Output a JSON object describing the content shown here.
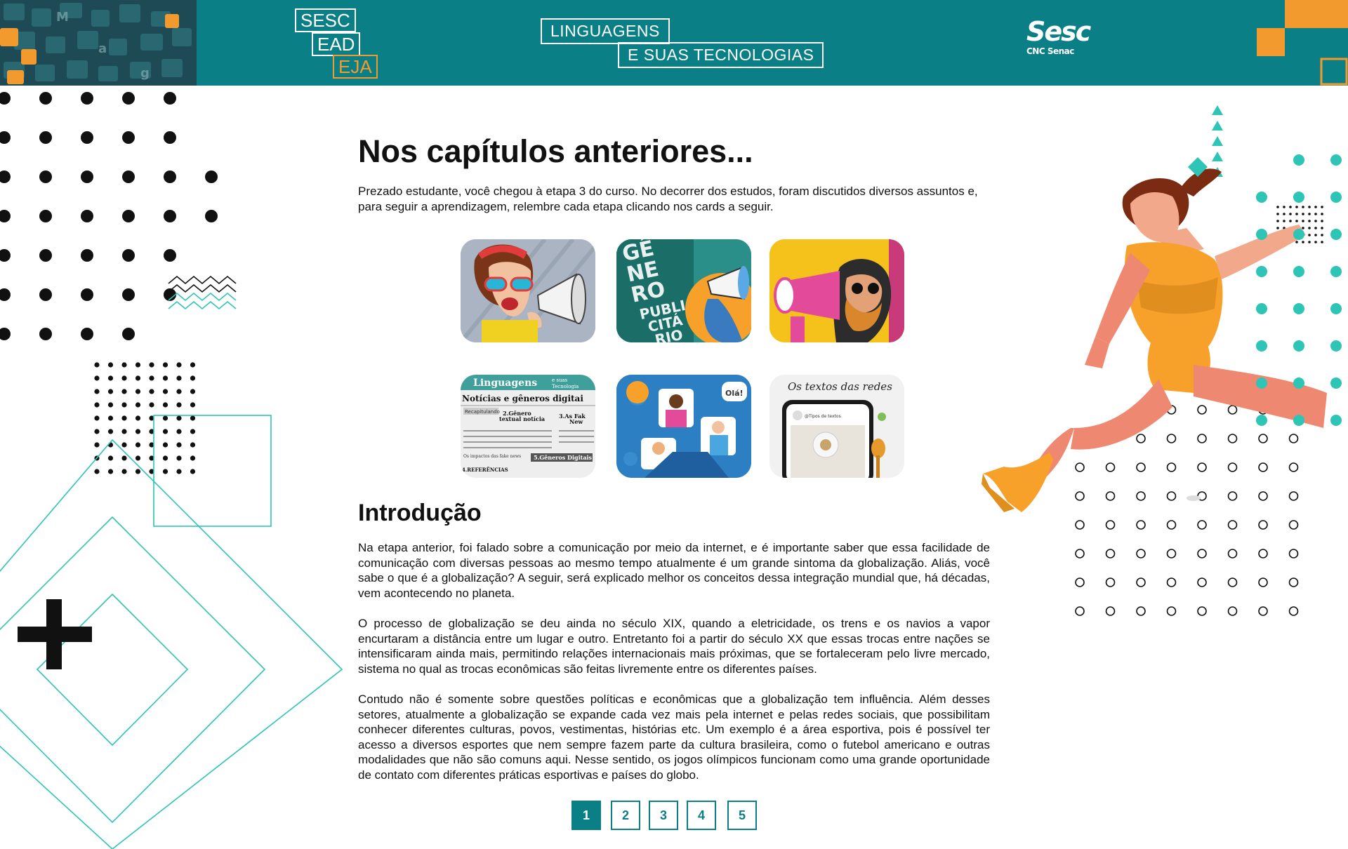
{
  "header": {
    "logo_eja": {
      "line1": "SESC",
      "line2": "EAD",
      "line3": "EJA"
    },
    "course_title": {
      "line1": "LINGUAGENS",
      "line2": "E SUAS TECNOLOGIAS"
    },
    "brand": {
      "name": "Sesc",
      "sub": "CNC Senac"
    }
  },
  "main": {
    "title": "Nos capítulos anteriores...",
    "lead": "Prezado estudante, você chegou à etapa 3 do curso. No decorrer dos estudos, foram discutidos diversos assuntos e, para seguir a aprendizagem, relembre cada etapa clicando nos cards a seguir.",
    "cards": [
      {
        "text": "",
        "icon": "megaphone-woman-icon"
      },
      {
        "text": "GÊ NE RO PUBLI CITÁ RIO",
        "icon": "megaphone-icon"
      },
      {
        "text": "",
        "icon": "megaphone-man-icon"
      },
      {
        "text": "Linguagens e suas Tecnologias — Notícias e gêneros digitais — Recapitulando — 2.Gênero textual notícia — 3.As Fake News — 5.Gêneros Digitais — 4.REFERÊNCIAS",
        "icon": "newspaper-icon"
      },
      {
        "text": "Olá!",
        "icon": "video-call-icon"
      },
      {
        "text": "Os textos das redes",
        "icon": "phone-icon"
      }
    ],
    "section_title": "Introdução",
    "paragraphs": [
      "Na etapa anterior, foi falado sobre a comunicação por meio da internet, e é importante saber que essa facilidade de comunicação com diversas pessoas ao mesmo tempo atualmente é um grande sintoma da globalização. Aliás, você sabe o que é a globalização? A seguir, será explicado melhor os conceitos dessa integração mundial que, há décadas, vem acontecendo no planeta.",
      "O processo de globalização se deu ainda no século XIX, quando a eletricidade, os trens e os navios a vapor encurtaram a distância entre um lugar e outro. Entretanto foi a partir do século XX que essas trocas entre nações se intensificaram ainda mais, permitindo relações internacionais mais próximas, que se fortaleceram pelo livre mercado, sistema no qual as trocas econômicas são feitas livremente entre os diferentes países.",
      "Contudo não é somente sobre questões políticas e econômicas que a globalização tem influência. Além desses setores, atualmente a globalização se expande cada vez mais pela internet e pelas redes sociais, que possibilitam conhecer diferentes culturas, povos, vestimentas, histórias etc. Um exemplo é a área esportiva, pois é possível ter acesso a diversos esportes que nem sempre fazem parte da cultura brasileira, como o futebol americano e outras modalidades que não são comuns aqui. Nesse sentido, os jogos olímpicos funcionam como uma grande oportunidade de contato com diferentes práticas esportivas e países do globo."
    ]
  },
  "pagination": {
    "pages": [
      "1",
      "2",
      "3",
      "4",
      "5"
    ],
    "current": "1"
  },
  "colors": {
    "teal": "#0b7f86",
    "orange": "#f29a2e",
    "mint": "#2ec4b6"
  }
}
